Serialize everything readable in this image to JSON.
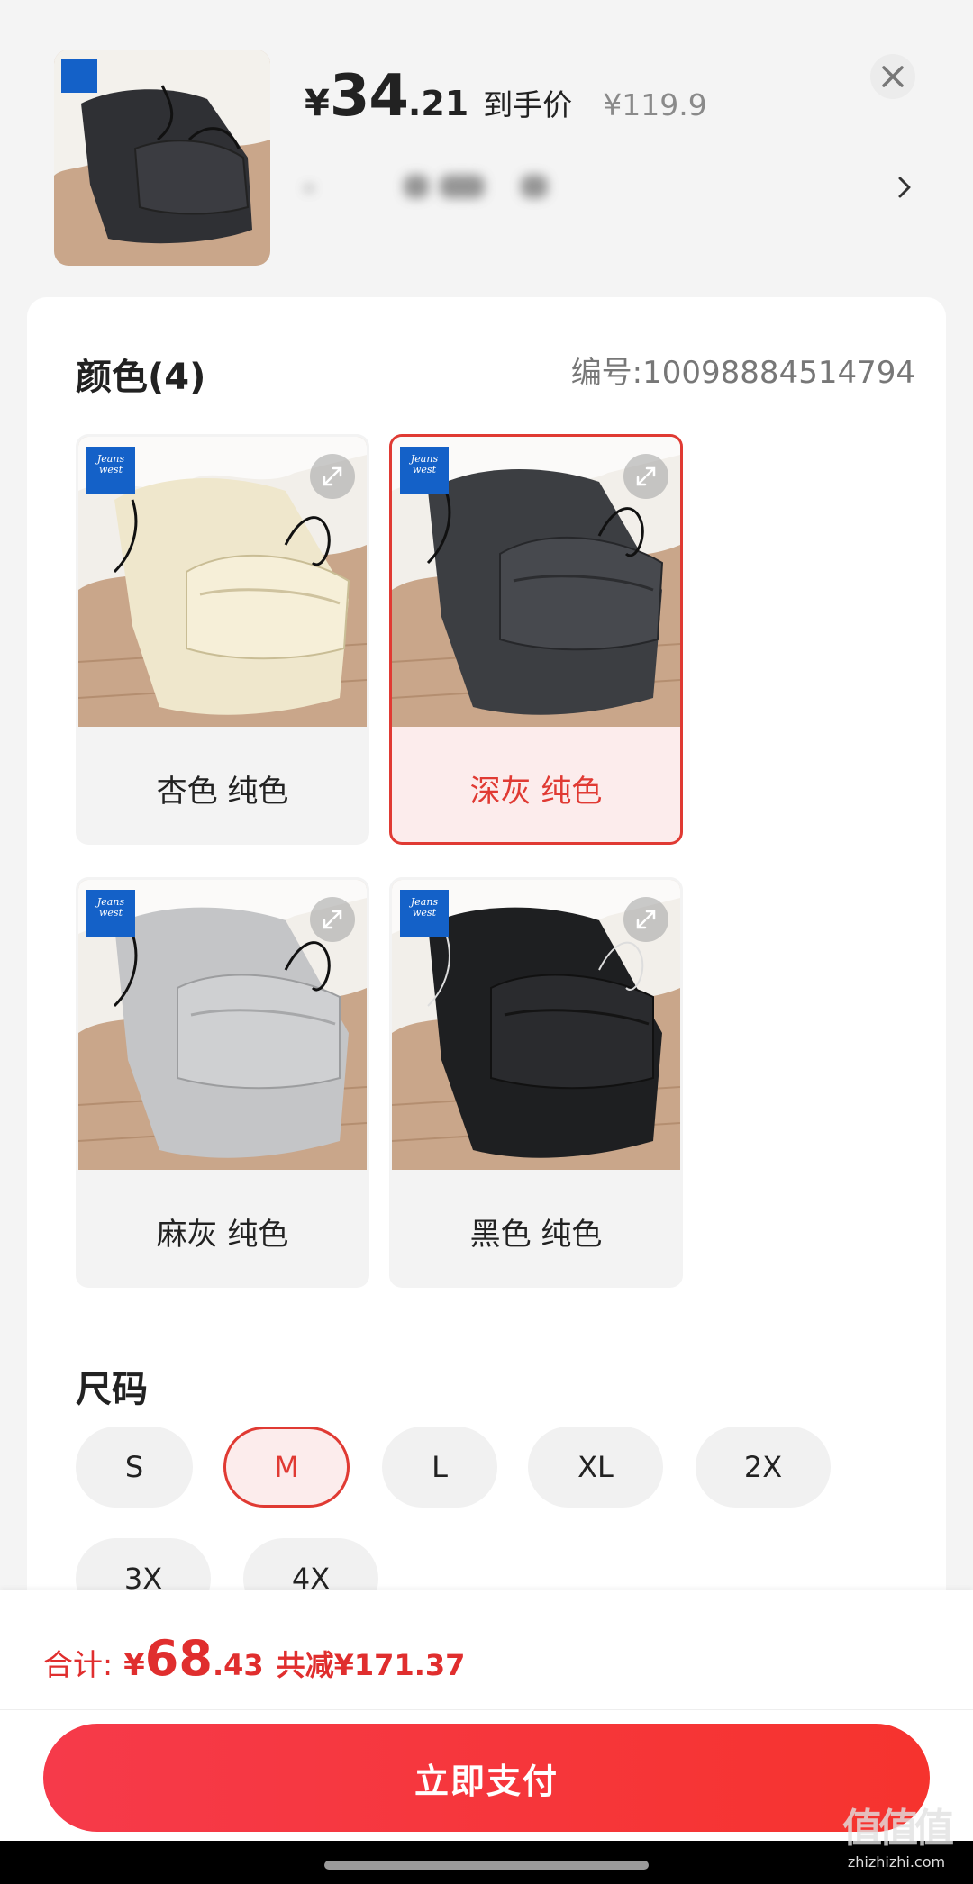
{
  "header": {
    "currency_symbol": "¥",
    "price_integer": "34",
    "price_decimal": ".21",
    "price_label": "到手价",
    "original_price": "¥119.9"
  },
  "color_section": {
    "title": "颜色(4)",
    "code_label": "编号:10098884514794",
    "options": [
      {
        "label": "杏色 纯色",
        "color": "#efe7cc",
        "selected": false
      },
      {
        "label": "深灰 纯色",
        "color": "#3c3e42",
        "selected": true
      },
      {
        "label": "麻灰 纯色",
        "color": "#c4c5c7",
        "selected": false
      },
      {
        "label": "黑色 纯色",
        "color": "#1e1f21",
        "selected": false
      }
    ]
  },
  "size_section": {
    "title": "尺码",
    "sizes": [
      {
        "label": "S",
        "selected": false
      },
      {
        "label": "M",
        "selected": true
      },
      {
        "label": "L",
        "selected": false
      },
      {
        "label": "XL",
        "selected": false
      },
      {
        "label": "2X",
        "selected": false
      },
      {
        "label": "3X",
        "selected": false
      },
      {
        "label": "4X",
        "selected": false
      }
    ]
  },
  "footer": {
    "total_label": "合计:",
    "total_currency": "¥",
    "total_integer": "68",
    "total_decimal": ".43",
    "total_saving": "共减¥171.37",
    "pay_button": "立即支付"
  },
  "brand_logo_text": "Jeans west 真维斯",
  "watermark": {
    "main": "值值值",
    "sub": "zhizhizhi.com"
  },
  "colors": {
    "accent_red": "#e03a33",
    "pay_button_red": "#f63a4a",
    "selected_bg": "#fcecec",
    "brand_blue": "#1461c8"
  }
}
